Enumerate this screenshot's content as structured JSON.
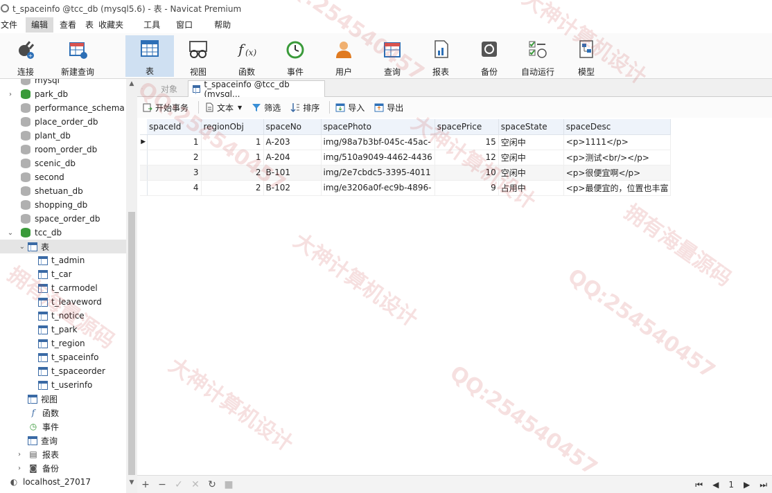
{
  "window": {
    "title": "t_spaceinfo @tcc_db (mysql5.6) - 表 - Navicat Premium"
  },
  "menu": [
    "文件",
    "编辑",
    "查看",
    "表",
    "收藏夹",
    "工具",
    "窗口",
    "帮助"
  ],
  "toolbar": {
    "items": [
      {
        "label": "连接",
        "icon": "plug-icon"
      },
      {
        "label": "新建查询",
        "icon": "new-query-icon"
      },
      {
        "label": "表",
        "icon": "table-icon"
      },
      {
        "label": "视图",
        "icon": "view-icon"
      },
      {
        "label": "函数",
        "icon": "function-icon"
      },
      {
        "label": "事件",
        "icon": "clock-icon"
      },
      {
        "label": "用户",
        "icon": "user-icon"
      },
      {
        "label": "查询",
        "icon": "query-icon"
      },
      {
        "label": "报表",
        "icon": "report-icon"
      },
      {
        "label": "备份",
        "icon": "backup-icon"
      },
      {
        "label": "自动运行",
        "icon": "automation-icon"
      },
      {
        "label": "模型",
        "icon": "model-icon"
      }
    ],
    "active": "表"
  },
  "sidebar": {
    "databases": [
      "mysql",
      "park_db",
      "performance_schema",
      "place_order_db",
      "plant_db",
      "room_order_db",
      "scenic_db",
      "second",
      "shetuan_db",
      "shopping_db",
      "space_order_db",
      "tcc_db"
    ],
    "tables_label": "表",
    "tables": [
      "t_admin",
      "t_car",
      "t_carmodel",
      "t_leaveword",
      "t_notice",
      "t_park",
      "t_region",
      "t_spaceinfo",
      "t_spaceorder",
      "t_userinfo"
    ],
    "other_items": [
      {
        "label": "视图",
        "icon": "view-icon"
      },
      {
        "label": "函数",
        "icon": "function-icon"
      },
      {
        "label": "事件",
        "icon": "clock-icon"
      },
      {
        "label": "查询",
        "icon": "query-icon"
      },
      {
        "label": "报表",
        "icon": "report-icon"
      },
      {
        "label": "备份",
        "icon": "backup-icon"
      }
    ],
    "connection": "localhost_27017"
  },
  "tabs": {
    "objects": "对象",
    "current": "t_spaceinfo @tcc_db (mysql..."
  },
  "content_toolbar": {
    "begin_transaction": "开始事务",
    "text": "文本",
    "filter": "筛选",
    "sort": "排序",
    "import": "导入",
    "export": "导出"
  },
  "grid": {
    "columns": [
      "spaceId",
      "regionObj",
      "spaceNo",
      "spacePhoto",
      "spacePrice",
      "spaceState",
      "spaceDesc"
    ],
    "rows": [
      [
        "1",
        "1",
        "A-203",
        "img/98a7b3bf-045c-45ac-",
        "15",
        "空闲中",
        "<p>1111</p>"
      ],
      [
        "2",
        "1",
        "A-204",
        "img/510a9049-4462-4436",
        "12",
        "空闲中",
        "<p>测试<br/></p>"
      ],
      [
        "3",
        "2",
        "B-101",
        "img/2e7cbdc5-3395-4011",
        "10",
        "空闲中",
        "<p>很便宜啊</p>"
      ],
      [
        "4",
        "2",
        "B-102",
        "img/e3206a0f-ec9b-4896-",
        "9",
        "占用中",
        "<p>最便宜的，位置也丰富"
      ]
    ]
  },
  "pager": {
    "page": "1"
  },
  "watermark": {
    "lines": [
      "大神计算机设计",
      "QQ:254540457",
      "拥有海量源码"
    ]
  }
}
